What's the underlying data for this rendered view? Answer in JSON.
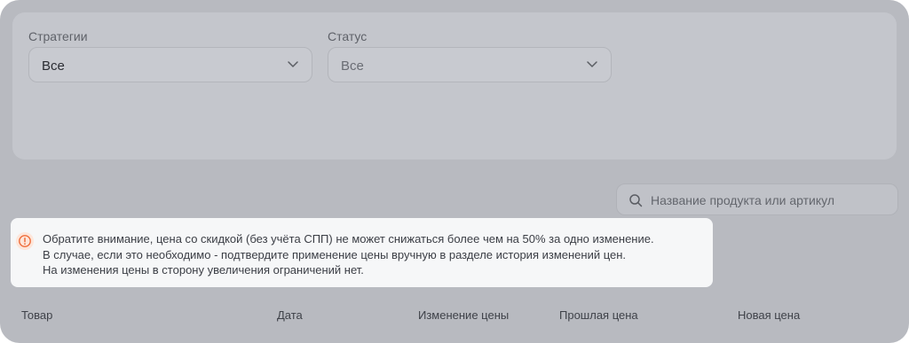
{
  "filters": {
    "strategy": {
      "label": "Стратегии",
      "value": "Все"
    },
    "status": {
      "label": "Статус",
      "value": "Все"
    }
  },
  "search": {
    "placeholder": "Название продукта или артикул",
    "icon": "search-icon"
  },
  "notice": {
    "icon": "warning-circle-icon",
    "accent": "#ef6c3a",
    "lines": [
      "Обратите внимание, цена со скидкой (без учёта СПП) не может снижаться более чем на 50% за одно изменение.",
      "В случае, если это необходимо - подтвердите применение цены вручную в разделе история изменений цен.",
      "На изменения цены в сторону увеличения ограничений нет."
    ]
  },
  "table": {
    "columns": [
      "Товар",
      "Дата",
      "Изменение цены",
      "Прошлая цена",
      "Новая цена"
    ]
  }
}
